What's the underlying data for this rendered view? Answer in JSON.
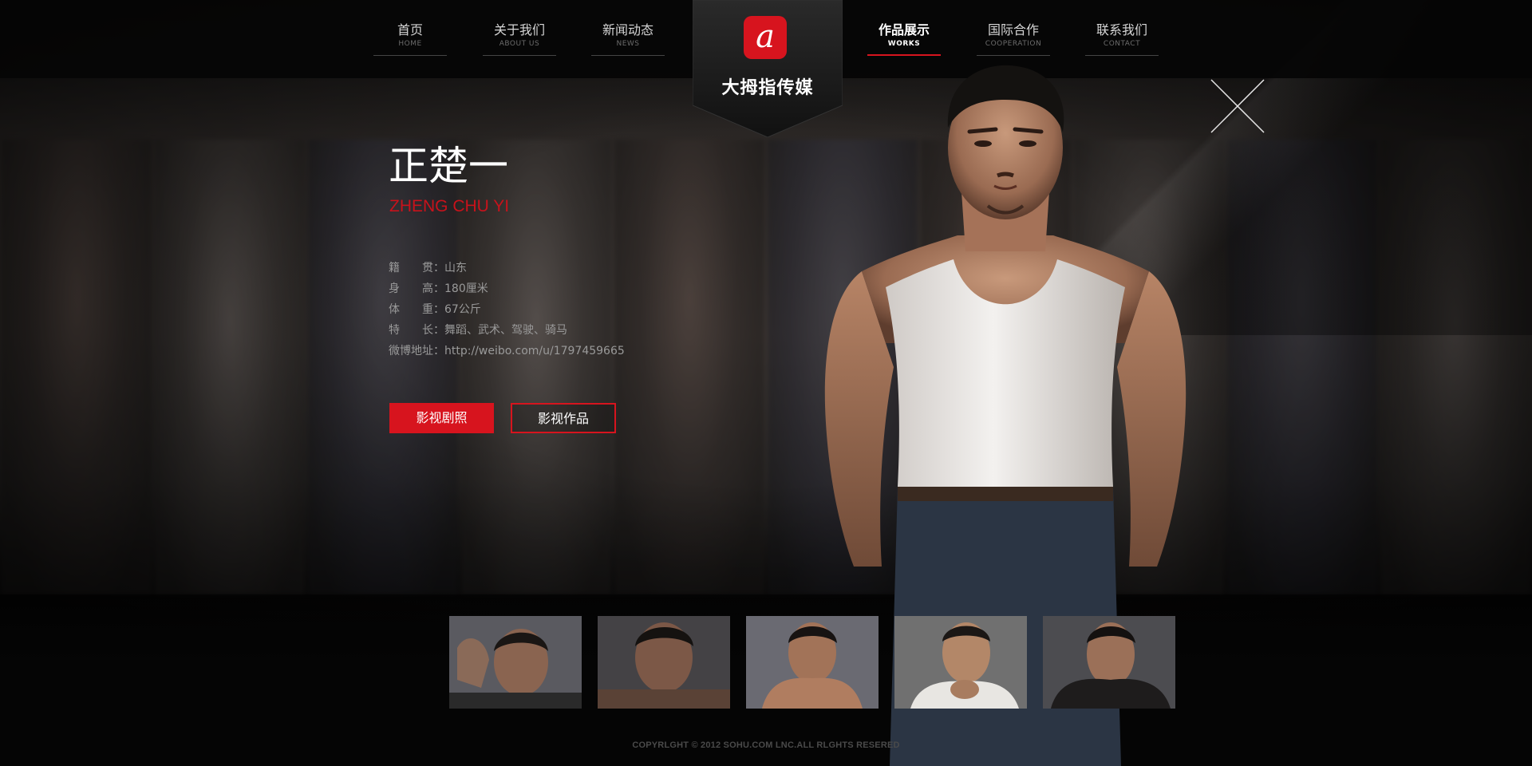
{
  "nav": {
    "left": [
      {
        "cn": "首页",
        "en": "HOME"
      },
      {
        "cn": "关于我们",
        "en": "ABOUT US"
      },
      {
        "cn": "新闻动态",
        "en": "NEWS"
      }
    ],
    "right": [
      {
        "cn": "作品展示",
        "en": "WORKS",
        "active": true
      },
      {
        "cn": "国际合作",
        "en": "COOPERATION"
      },
      {
        "cn": "联系我们",
        "en": "CONTACT"
      }
    ]
  },
  "logo": {
    "text": "大拇指传媒",
    "mark": "a"
  },
  "profile": {
    "name_cn": "正楚一",
    "name_en": "ZHENG CHU YI",
    "info": [
      {
        "label": "籍　贯",
        "value": "山东"
      },
      {
        "label": "身　高",
        "value": "180厘米"
      },
      {
        "label": "体　重",
        "value": "67公斤"
      },
      {
        "label": "特　长",
        "value": "舞蹈、武术、驾驶、骑马"
      },
      {
        "label": "微博地址",
        "value": "http://weibo.com/u/1797459665"
      }
    ]
  },
  "buttons": {
    "photos": "影视剧照",
    "works": "影视作品"
  },
  "icons": {
    "close": "close-icon",
    "logo": "logo-mark-icon"
  },
  "colors": {
    "accent": "#d7141e",
    "background": "#070707",
    "text_muted": "#9a9a9a"
  },
  "thumbnails": [
    {
      "alt": "剧照1"
    },
    {
      "alt": "剧照2"
    },
    {
      "alt": "剧照3"
    },
    {
      "alt": "剧照4"
    },
    {
      "alt": "剧照5"
    }
  ],
  "footer": {
    "copyright": "COPYRLGHT © 2012 SOHU.COM LNC.ALL RLGHTS RESERED"
  }
}
